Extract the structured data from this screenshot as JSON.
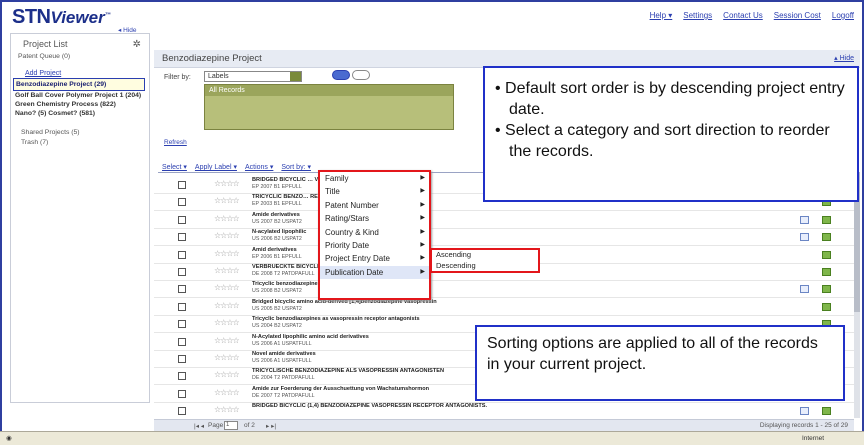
{
  "header": {
    "logo_stn": "STN",
    "logo_viewer": "Viewer",
    "logo_tm": "™",
    "links": [
      "Help ▾",
      "Settings",
      "Contact Us",
      "Session Cost",
      "Logoff"
    ],
    "hide_left": "◂ Hide"
  },
  "sidebar": {
    "title": "Project List",
    "patent_queue": "Patent Queue (0)",
    "add_project": "Add Project",
    "selected_project": "Benzodiazepine Project (29)",
    "projects": [
      "Golf Ball Cover Polymer Project 1 (204)",
      "Green Chemistry Process (822)",
      "Nano? (5) Cosmet? (581)"
    ],
    "shared": "Shared Projects (5)",
    "trash": "Trash (7)"
  },
  "main": {
    "title": "Benzodiazepine Project",
    "hide_right": "▴ Hide",
    "filter_label": "Filter by:",
    "filter_value": "Labels",
    "records_label": "All Records",
    "refresh": "Refresh",
    "toolbar": [
      "Select ▾",
      "Apply Label ▾",
      "Actions ▾",
      "Sort by: ▾"
    ]
  },
  "records": [
    {
      "title": "BRIDGED BICYCLIC … VASOPRESSIN RECEPTOR",
      "source": "EP 2007 B1 EPFULL",
      "icons": [
        "green"
      ]
    },
    {
      "title": "TRICYCLIC BENZO… RECEPTOR ANTAGONISTS.",
      "source": "EP 2003 B1 EPFULL",
      "icons": [
        "green"
      ]
    },
    {
      "title": "Amide derivatives",
      "source": "US 2007 B2 USPAT2",
      "icons": [
        "doc",
        "green"
      ]
    },
    {
      "title": "N-acylated lipophilic",
      "source": "US 2006 B2 USPAT2",
      "icons": [
        "doc",
        "green"
      ]
    },
    {
      "title": "Amid derivatives",
      "source": "EP 2006 B1 EPFULL",
      "icons": [
        "green"
      ]
    },
    {
      "title": "VERBRUECKTE BICYCLISCHE (1,4) BENZODIAZEPINE … ANTAGONISTEN",
      "source": "DE 2008 T2 PATDPAFULL",
      "icons": [
        "green"
      ]
    },
    {
      "title": "Tricyclic benzodiazepines as vasopressin receptor antagonists",
      "source": "US 2008 B2 USPAT2",
      "icons": [
        "doc",
        "green"
      ]
    },
    {
      "title": "Bridged bicyclic amino acid-derived [1,4]benzodiazepine vasopressin",
      "source": "US 2005 B2 USPAT2",
      "icons": [
        "green"
      ]
    },
    {
      "title": "Tricyclic benzodiazepines as vasopressin receptor antagonists",
      "source": "US 2004 B2 USPAT2",
      "icons": [
        "green"
      ]
    },
    {
      "title": "N-Acylated lipophilic amino acid derivatives",
      "source": "US 2006 A1 USPATFULL",
      "icons": [
        "green"
      ]
    },
    {
      "title": "Novel amide derivatives",
      "source": "US 2006 A1 USPATFULL",
      "icons": [
        "green"
      ]
    },
    {
      "title": "TRICYCLISCHE BENZODIAZEPINE ALS VASOPRESSIN ANTAGONISTEN",
      "source": "DE 2004 T2 PATDPAFULL",
      "icons": [
        "green"
      ]
    },
    {
      "title": "Amide zur Foerderung der Ausschuettung von Wachstumshormon",
      "source": "DE 2007 T2 PATDPAFULL",
      "icons": [
        "green"
      ]
    },
    {
      "title": "BRIDGED BICYCLIC (1,4) BENZODIAZEPINE VASOPRESSIN RECEPTOR ANTAGONISTS.",
      "source": "",
      "icons": [
        "doc",
        "green"
      ]
    }
  ],
  "sort_menu": {
    "items": [
      "Family",
      "Title",
      "Patent Number",
      "Rating/Stars",
      "Country & Kind",
      "Priority Date",
      "Project Entry Date",
      "Publication Date"
    ],
    "active": "Publication Date",
    "submenu": [
      "Ascending",
      "Descending"
    ]
  },
  "pager": {
    "page_label": "Page",
    "page_value": "1",
    "of_label": "of 2",
    "display": "Displaying records 1 - 25 of 29"
  },
  "status": {
    "zone": "Internet"
  },
  "callouts": {
    "top": [
      "Default sort order is by descending project entry date.",
      "Select a category and sort direction to reorder the records."
    ],
    "bottom": "Sorting options are applied to all of the records in your current project."
  },
  "colors": {
    "brand": "#1c2f8a",
    "link": "#2b3fb0",
    "highlight": "#e3161b",
    "callout_border": "#2030c8"
  }
}
